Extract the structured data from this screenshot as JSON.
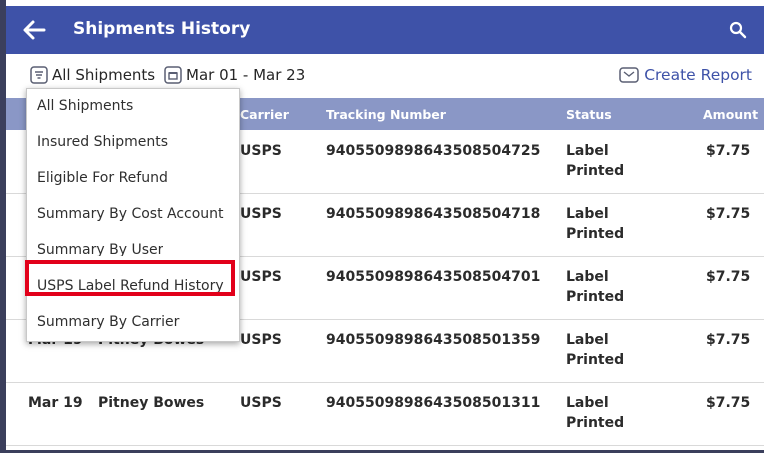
{
  "header": {
    "title": "Shipments History",
    "back_icon": "back-arrow-icon",
    "search_icon": "search-icon"
  },
  "filters": {
    "type_label": "All Shipments",
    "date_label": "Mar 01 - Mar 23",
    "report_label": "Create Report"
  },
  "columns": {
    "carrier": "Carrier",
    "tracking": "Tracking Number",
    "status": "Status",
    "amount": "Amount"
  },
  "rows": [
    {
      "date": "",
      "carrier_name": "",
      "carrier": "USPS",
      "tracking": "9405509898643508504725",
      "status_l1": "Label",
      "status_l2": "Printed",
      "amount": "$7.75"
    },
    {
      "date": "",
      "carrier_name": "",
      "carrier": "USPS",
      "tracking": "9405509898643508504718",
      "status_l1": "Label",
      "status_l2": "Printed",
      "amount": "$7.75"
    },
    {
      "date": "",
      "carrier_name": "",
      "carrier": "USPS",
      "tracking": "9405509898643508504701",
      "status_l1": "Label",
      "status_l2": "Printed",
      "amount": "$7.75"
    },
    {
      "date": "Mar 19",
      "carrier_name": "Pitney Bowes",
      "carrier": "USPS",
      "tracking": "9405509898643508501359",
      "status_l1": "Label",
      "status_l2": "Printed",
      "amount": "$7.75"
    },
    {
      "date": "Mar 19",
      "carrier_name": "Pitney Bowes",
      "carrier": "USPS",
      "tracking": "9405509898643508501311",
      "status_l1": "Label",
      "status_l2": "Printed",
      "amount": "$7.75"
    }
  ],
  "menu": {
    "items": [
      "All Shipments",
      "Insured Shipments",
      "Eligible For Refund",
      "Summary By Cost Account",
      "Summary By User",
      "USPS Label Refund History",
      "Summary By Carrier"
    ],
    "highlighted_index": 5,
    "highlight_color": "#e2001a"
  },
  "colors": {
    "topbar": "#3e52a8",
    "table_header": "#8a97c6",
    "link": "#3e52a8"
  }
}
